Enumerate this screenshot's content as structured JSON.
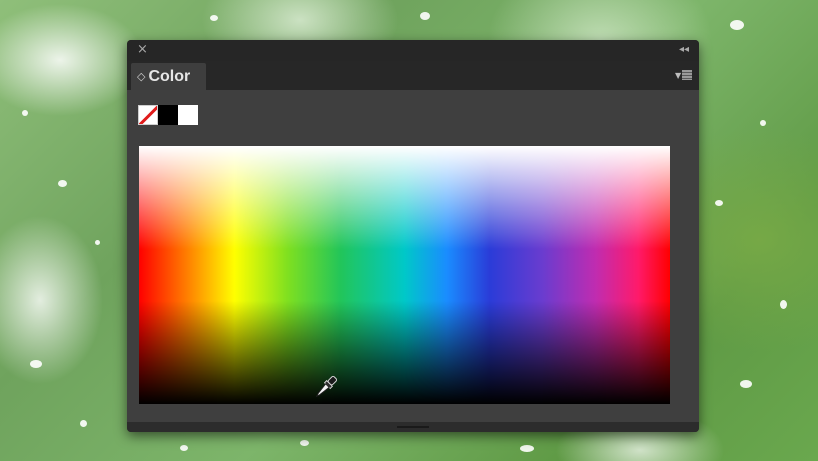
{
  "panel": {
    "close_glyph": "×",
    "collapse_glyph": "◂◂",
    "tab": {
      "arrows_glyph": "◇",
      "label": "Color"
    },
    "menu_icon": "panel-menu-icon"
  },
  "swatches": [
    {
      "name": "none",
      "color": "#ffffff"
    },
    {
      "name": "black",
      "color": "#000000"
    },
    {
      "name": "white",
      "color": "#ffffff"
    }
  ],
  "spectrum": {
    "cursor": "eyedropper-icon"
  },
  "colors": {
    "panel_bg": "#3f3f3f",
    "titlebar_bg": "#262626",
    "tab_bg": "#3e3e3e",
    "none_slash": "#e01b1b"
  }
}
